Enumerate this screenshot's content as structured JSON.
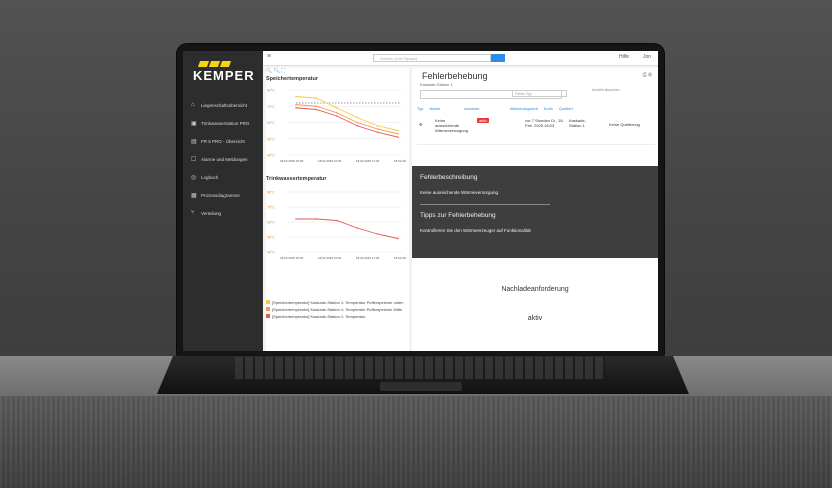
{
  "brand": {
    "name": "KEMPER"
  },
  "topbar": {
    "search_placeholder": "Suchen (Ctrl+Space)",
    "help": "Hilfe",
    "user": "Jon"
  },
  "sidebar": {
    "items": [
      {
        "label": "Liegenschaftsübersicht",
        "icon": "building-icon"
      },
      {
        "label": "Trinkwasserstation PRO",
        "icon": "station-icon"
      },
      {
        "label": "FR 5 PRO - Übersicht",
        "icon": "overview-icon"
      },
      {
        "label": "Alarme und Meldungen",
        "icon": "alarm-icon"
      },
      {
        "label": "Logbuch",
        "icon": "log-icon"
      },
      {
        "label": "Prozessdiagramme",
        "icon": "diagram-icon"
      },
      {
        "label": "Verteilung",
        "icon": "distribution-icon"
      }
    ]
  },
  "charts": {
    "chart1": {
      "title": "Speichertemperatur"
    },
    "chart2": {
      "title": "Trinkwassertemperatur"
    },
    "legend": [
      {
        "text": "[Speichertemperatur] Kaskade-Station 1: Temperatur Pufferspeicher unten",
        "color": "#f2c94c"
      },
      {
        "text": "[Speichertemperatur] Kaskade-Station 1: Temperatur Pufferspeicher Mitte",
        "color": "#f2994a"
      },
      {
        "text": "[Speichertemperatur] Kaskade-Station 1: Temperatur",
        "color": "#eb5757"
      }
    ]
  },
  "main": {
    "title": "Fehlerbehebung",
    "breadcrumb": "Kaskade-Station 1",
    "filter_placeholder": "Fehler-Typ",
    "reset_label": "Ansicht absuchen",
    "columns": [
      "Typ",
      "Name",
      "Auslöser",
      "Aktivierungszeit",
      "Kreis",
      "Quittiert"
    ],
    "row": {
      "name": "Keine ausreichende Wärmeversorgung",
      "trigger": "aktiv",
      "time": "vor 7 Stunden Di., 18. Feb. 2025 16:03",
      "circuit": "Kaskade-Station 1",
      "ack": "Keine Quittierung"
    },
    "description_heading": "Fehlerbeschreibung",
    "description_text": "Keine ausreichende Wärmeversorgung",
    "tips_heading": "Tipps zur Fehlerbehebung",
    "tips_text": "Kontrollieren Sie den Wärmeerzeuger auf Funktionalität",
    "recharge_label": "Nachladeanforderung",
    "recharge_status": "aktiv"
  },
  "chart_data": [
    {
      "type": "line",
      "title": "Speichertemperatur",
      "x": [
        "18.02.2025 15:00",
        "18.02.2025 16:00",
        "18.02.2025 17:00",
        "18.02.2025 18:00"
      ],
      "series": [
        {
          "values": [
            76,
            75,
            69,
            63,
            58,
            55
          ]
        },
        {
          "values": [
            71,
            70,
            66,
            60,
            56,
            53
          ]
        },
        {
          "values": [
            69,
            68,
            64,
            58,
            54,
            51
          ]
        }
      ],
      "ylim": [
        40,
        80
      ]
    },
    {
      "type": "line",
      "title": "Trinkwassertemperatur",
      "x": [
        "18.02.2025 15:00",
        "18.02.2025 16:00",
        "18.02.2025 17:00",
        "18.02.2025 18:00"
      ],
      "series": [
        {
          "values": [
            62,
            62,
            61,
            56,
            52,
            49
          ]
        }
      ],
      "ylim": [
        40,
        80
      ]
    }
  ]
}
